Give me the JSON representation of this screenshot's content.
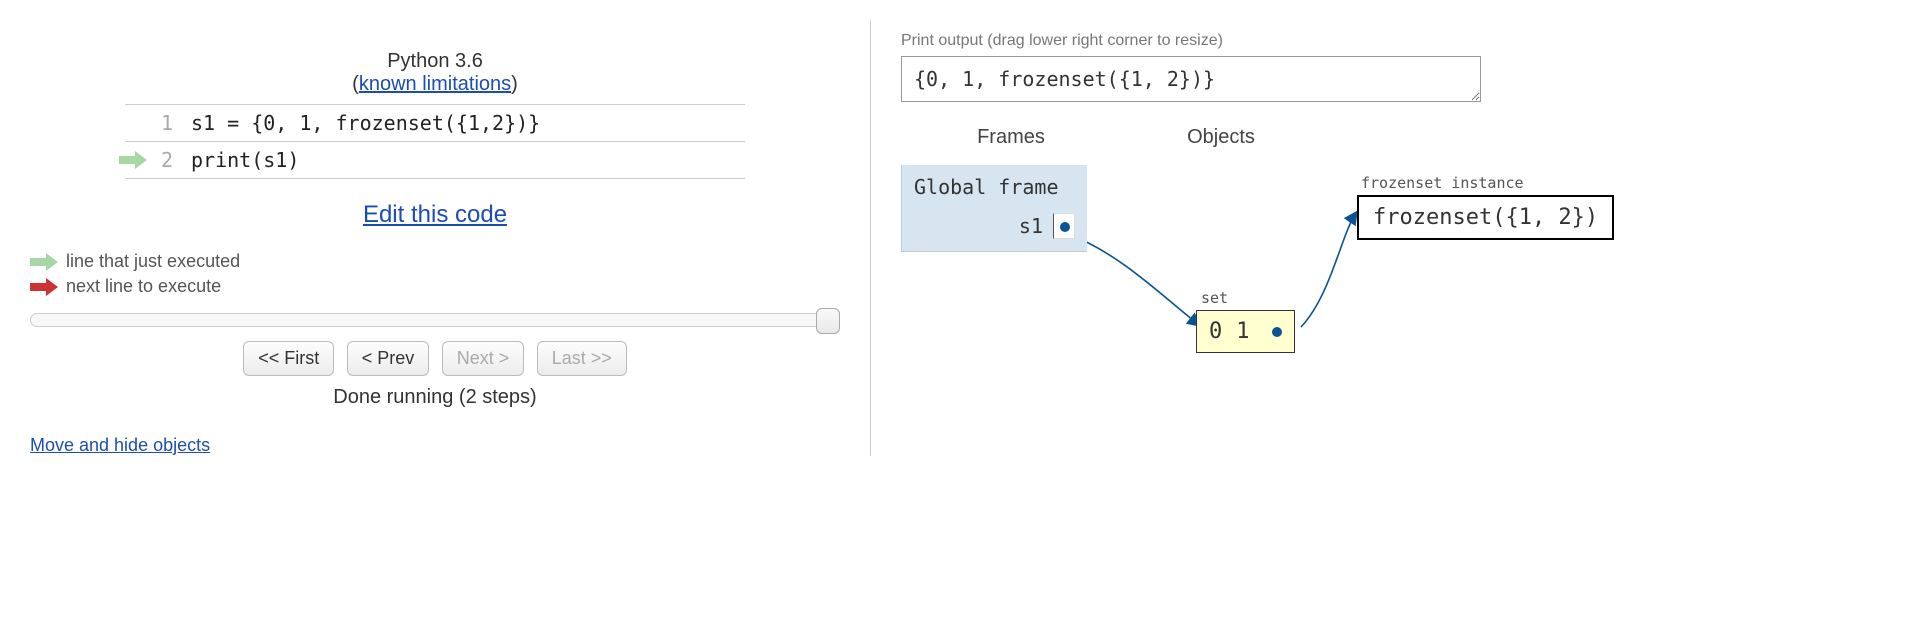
{
  "header": {
    "python_version": "Python 3.6",
    "limitations_link": "known limitations"
  },
  "code": {
    "lines": [
      {
        "num": "1",
        "text": "s1 = {0, 1, frozenset({1,2})}"
      },
      {
        "num": "2",
        "text": "print(s1)"
      }
    ],
    "just_executed_line": 2
  },
  "edit_link": "Edit this code",
  "legend": {
    "just_executed": "line that just executed",
    "next_to_execute": "next line to execute"
  },
  "nav": {
    "first": "<< First",
    "prev": "< Prev",
    "next": "Next >",
    "last": "Last >>"
  },
  "status": "Done running (2 steps)",
  "move_hide": "Move and hide objects",
  "output": {
    "label": "Print output (drag lower right corner to resize)",
    "content": "{0, 1, frozenset({1, 2})}"
  },
  "viz_headers": {
    "frames": "Frames",
    "objects": "Objects"
  },
  "frame": {
    "title": "Global frame",
    "vars": [
      {
        "name": "s1"
      }
    ]
  },
  "objects": {
    "set": {
      "label": "set",
      "items": [
        "0",
        "1"
      ]
    },
    "frozenset": {
      "label": "frozenset instance",
      "repr": "frozenset({1, 2})"
    }
  },
  "colors": {
    "arrow_just": "#a7d7a7",
    "arrow_next": "#cc3333",
    "pointer": "#0b5394",
    "frame_bg": "#d7e5f0",
    "set_bg": "#ffffcf"
  }
}
